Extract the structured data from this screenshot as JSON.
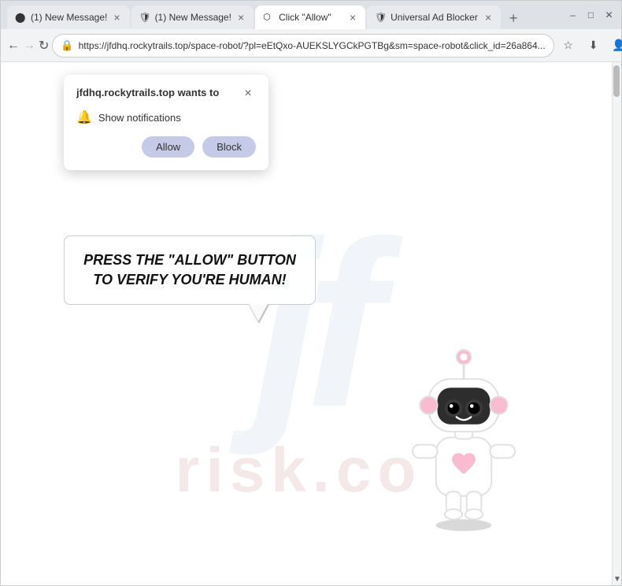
{
  "browser": {
    "tabs": [
      {
        "id": "tab1",
        "title": "(1) New Message!",
        "icon": "circle-icon",
        "active": false,
        "favicon": "●"
      },
      {
        "id": "tab2",
        "title": "(1) New Message!",
        "icon": "shield-icon",
        "active": false,
        "favicon": "🛡"
      },
      {
        "id": "tab3",
        "title": "Click \"Allow\"",
        "icon": "cursor-icon",
        "active": true,
        "favicon": "⬡"
      },
      {
        "id": "tab4",
        "title": "Universal Ad Blocker",
        "icon": "shield-icon",
        "active": false,
        "favicon": "🛡"
      }
    ],
    "url": "https://jfdhq.rockytrails.top/space-robot/?pl=eEtQxo-AUEKSLYGCkPGTBg&sm=space-robot&click_id=26a864...",
    "back_disabled": false,
    "forward_disabled": true
  },
  "permission_popup": {
    "title": "jfdhq.rockytrails.top wants to",
    "notification_label": "Show notifications",
    "allow_label": "Allow",
    "block_label": "Block",
    "close_label": "×"
  },
  "page": {
    "bubble_text": "PRESS THE \"ALLOW\" BUTTON TO VERIFY YOU'RE HUMAN!",
    "watermark_letters": "jf",
    "watermark_risk": "risk.co"
  },
  "nav": {
    "back": "←",
    "forward": "→",
    "reload": "↻",
    "new_tab": "+"
  }
}
